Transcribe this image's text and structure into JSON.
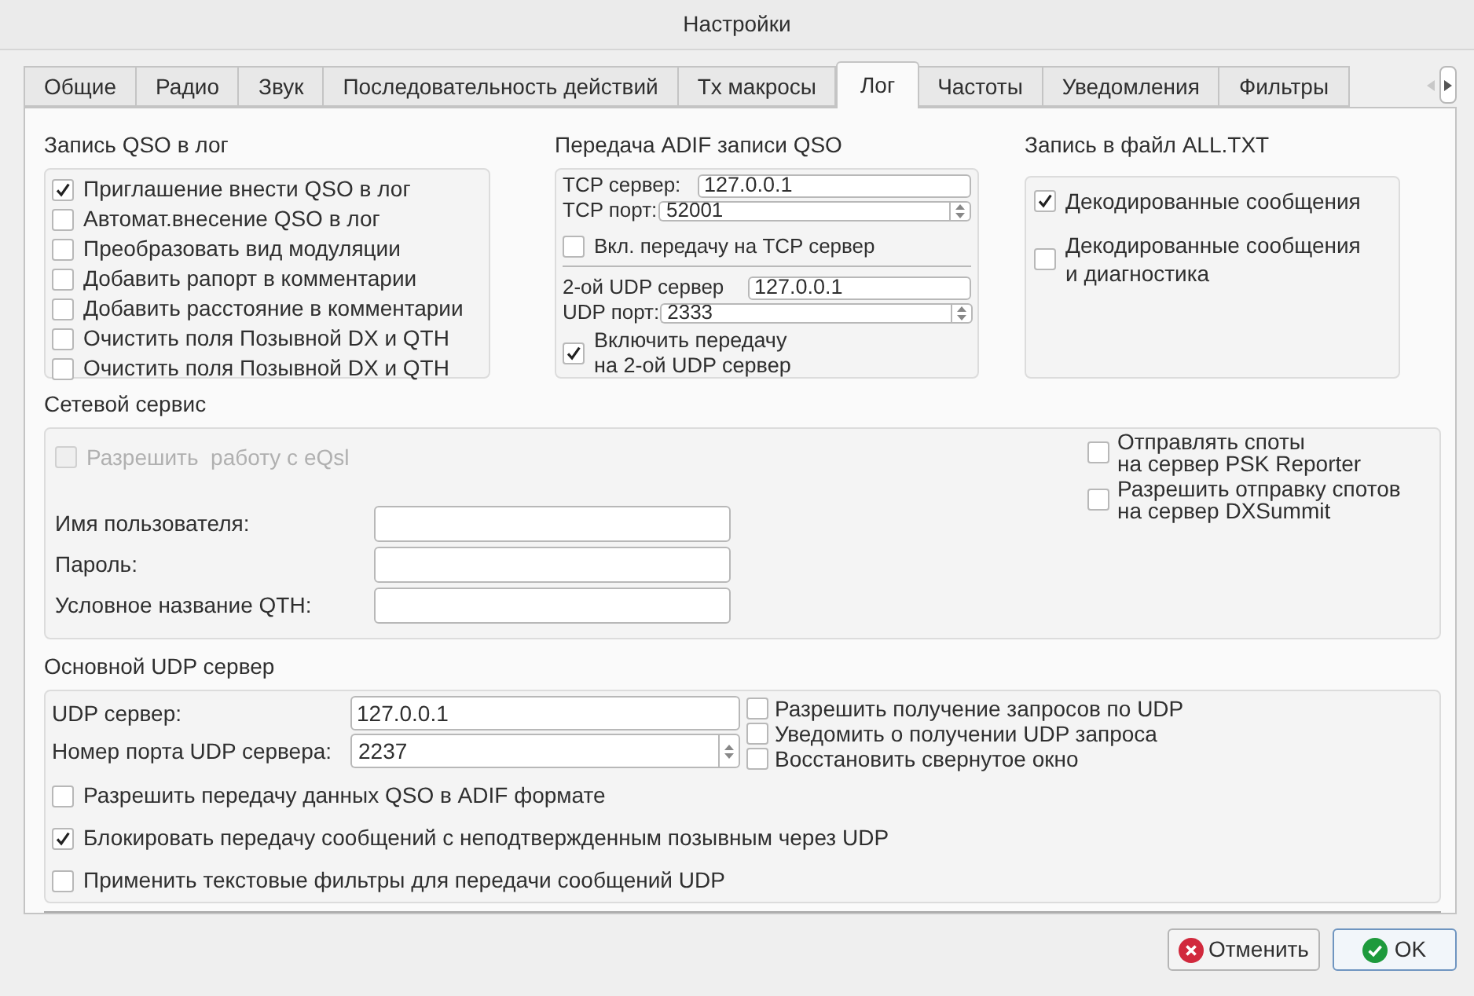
{
  "window": {
    "title": "Настройки"
  },
  "tabs": [
    {
      "label": "Общие",
      "selected": false
    },
    {
      "label": "Радио",
      "selected": false
    },
    {
      "label": "Звук",
      "selected": false
    },
    {
      "label": "Последовательность действий",
      "selected": false
    },
    {
      "label": "Tx макросы",
      "selected": false
    },
    {
      "label": "Лог",
      "selected": true
    },
    {
      "label": "Частоты",
      "selected": false
    },
    {
      "label": "Уведомления",
      "selected": false
    },
    {
      "label": "Фильтры",
      "selected": false
    }
  ],
  "log_section": {
    "title": "Запись QSO в лог",
    "options": [
      {
        "label": "Приглашение внести QSO в лог",
        "checked": true
      },
      {
        "label": "Автомат.внесение QSO в лог",
        "checked": false
      },
      {
        "label": "Преобразовать вид модуляции",
        "checked": false
      },
      {
        "label": "Добавить рапорт в комментарии",
        "checked": false
      },
      {
        "label": "Добавить расстояние в комментарии",
        "checked": false
      },
      {
        "label": "Очистить поля Позывной DX и QTH",
        "checked": false
      },
      {
        "label": "Очистить поля Позывной DX и QTH",
        "checked": false
      }
    ]
  },
  "adif": {
    "title": "Передача ADIF записи QSO",
    "tcp_server_label": "TCP сервер:",
    "tcp_server": "127.0.0.1",
    "tcp_port_label": "TCP порт:",
    "tcp_port": "52001",
    "tcp_enable": {
      "label": "Вкл. передачу на TCP сервер",
      "checked": false
    },
    "udp2_server_label": "2-ой UDP сервер",
    "udp2_server": "127.0.0.1",
    "udp2_port_label": "UDP порт:",
    "udp2_port": "2333",
    "udp2_enable": {
      "label": "Включить передачу\nна 2-ой UDP сервер",
      "checked": true
    }
  },
  "all_txt": {
    "title": "Запись в файл ALL.TXT",
    "options": [
      {
        "label": "Декодированные сообщения",
        "checked": true
      },
      {
        "label": "Декодированные сообщения\nи диагностика",
        "checked": false
      }
    ]
  },
  "network": {
    "title": "Сетевой сервис",
    "eqsl": {
      "label": "Разрешить  работу с eQsl",
      "checked": false,
      "disabled": true
    },
    "spots": [
      {
        "label": "Отправлять споты\nна сервер PSK Reporter",
        "checked": false
      },
      {
        "label": "Разрешить отправку спотов\nна сервер DXSummit",
        "checked": false
      }
    ],
    "fields": [
      {
        "label": "Имя пользователя:"
      },
      {
        "label": "Пароль:"
      },
      {
        "label": "Условное название QTH:"
      }
    ]
  },
  "udp_main": {
    "title": "Основной UDP сервер",
    "server_label": "UDP сервер:",
    "server": "127.0.0.1",
    "port_label": "Номер порта UDP сервера:",
    "port": "2237",
    "side_options": [
      {
        "label": "Разрешить получение запросов по UDP",
        "checked": false
      },
      {
        "label": "Уведомить о получении UDP запроса",
        "checked": false
      },
      {
        "label": "Восстановить свернутое окно",
        "checked": false
      }
    ],
    "options": [
      {
        "label": "Разрешить передачу данных QSO в ADIF формате",
        "checked": false
      },
      {
        "label": "Блокировать передачу сообщений с неподтвержденным позывным через UDP",
        "checked": true
      },
      {
        "label": "Применить текстовые фильтры для передачи сообщений UDP",
        "checked": false
      }
    ]
  },
  "buttons": [
    {
      "label": "Отменить",
      "kind": "cancel"
    },
    {
      "label": "OK",
      "kind": "ok"
    }
  ]
}
